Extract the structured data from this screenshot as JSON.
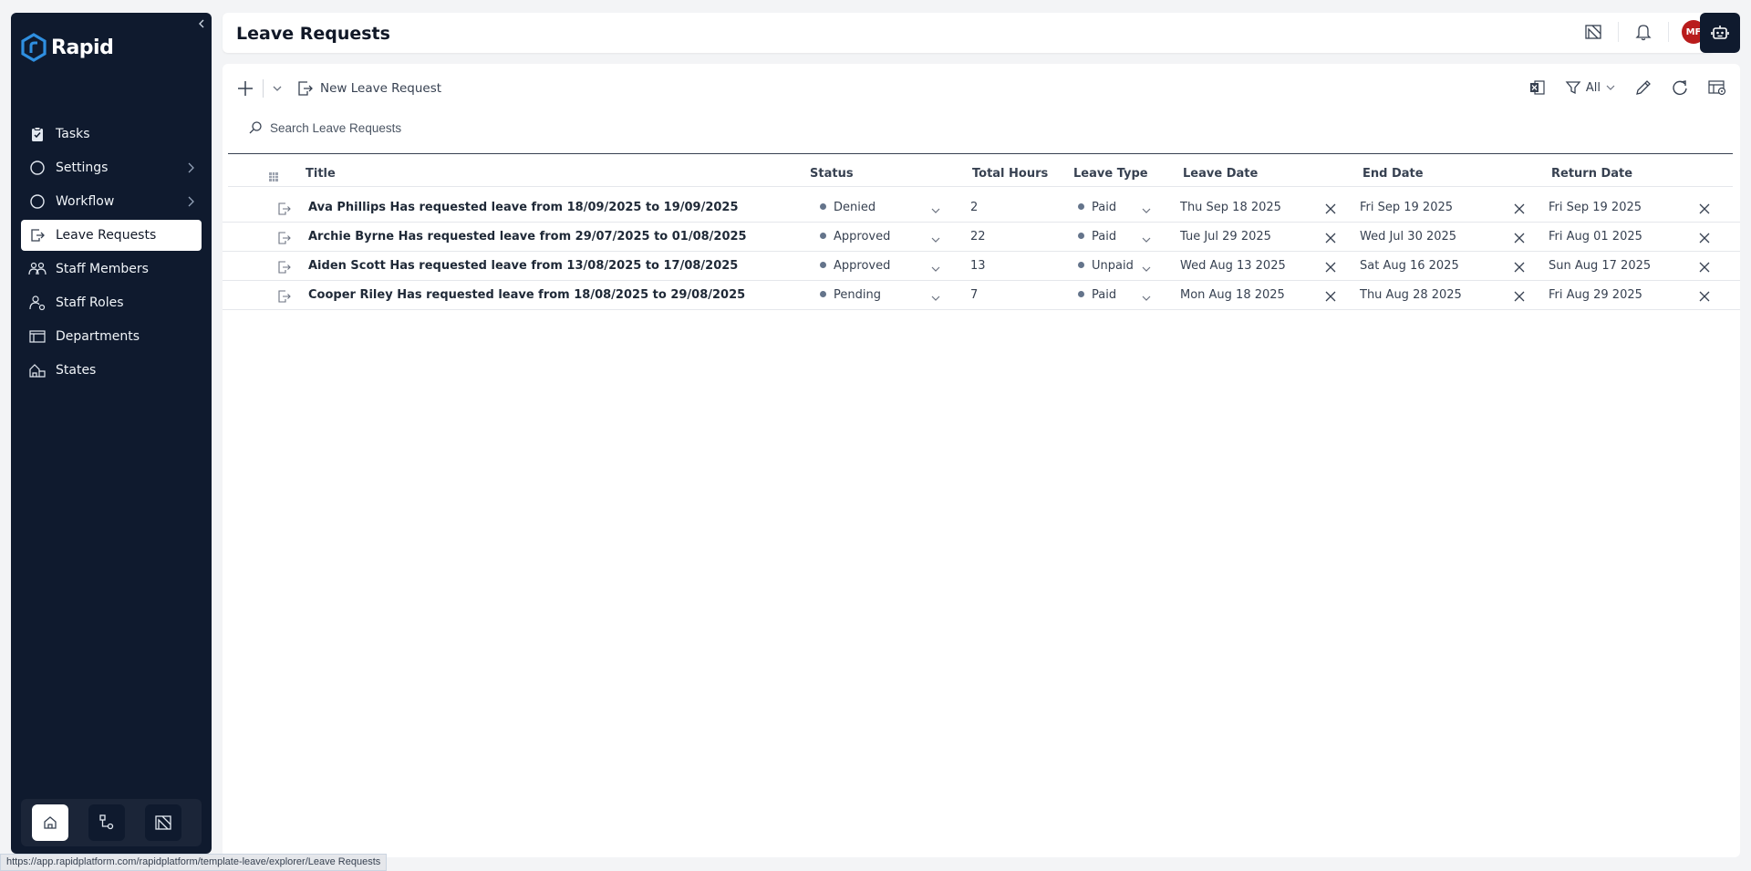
{
  "app": {
    "logo_text": "Rapid",
    "page_title": "Leave Requests",
    "avatar_initials": "MF"
  },
  "sidebar": {
    "items": [
      {
        "label": "Tasks",
        "icon": "clipboard-icon"
      },
      {
        "label": "Settings",
        "icon": "circle-icon"
      },
      {
        "label": "Workflow",
        "icon": "circle-icon"
      },
      {
        "label": "Leave Requests",
        "icon": "door-exit-icon"
      },
      {
        "label": "Staff Members",
        "icon": "people-icon"
      },
      {
        "label": "Staff Roles",
        "icon": "roles-icon"
      },
      {
        "label": "Departments",
        "icon": "table-icon"
      },
      {
        "label": "States",
        "icon": "buildings-icon"
      }
    ]
  },
  "toolbar": {
    "new_label": "New Leave Request",
    "filter_label": "All",
    "search_placeholder": "Search Leave Requests"
  },
  "table": {
    "columns": [
      "Title",
      "Status",
      "Total Hours",
      "Leave Type",
      "Leave Date",
      "End Date",
      "Return Date"
    ],
    "rows": [
      {
        "title": "Ava Phillips Has requested leave from 18/09/2025 to 19/09/2025",
        "status": "Denied",
        "hours": "2",
        "type": "Paid",
        "leave_date": "Thu Sep 18 2025",
        "end_date": "Fri Sep 19 2025",
        "return_date": "Fri Sep 19 2025"
      },
      {
        "title": "Archie Byrne Has requested leave from 29/07/2025 to 01/08/2025",
        "status": "Approved",
        "hours": "22",
        "type": "Paid",
        "leave_date": "Tue Jul 29 2025",
        "end_date": "Wed Jul 30 2025",
        "return_date": "Fri Aug 01 2025"
      },
      {
        "title": "Aiden Scott Has requested leave from 13/08/2025 to 17/08/2025",
        "status": "Approved",
        "hours": "13",
        "type": "Unpaid",
        "leave_date": "Wed Aug 13 2025",
        "end_date": "Sat Aug 16 2025",
        "return_date": "Sun Aug 17 2025"
      },
      {
        "title": "Cooper Riley Has requested leave from 18/08/2025 to 29/08/2025",
        "status": "Pending",
        "hours": "7",
        "type": "Paid",
        "leave_date": "Mon Aug 18 2025",
        "end_date": "Thu Aug 28 2025",
        "return_date": "Fri Aug 29 2025"
      }
    ]
  },
  "statusbar": {
    "url": "https://app.rapidplatform.com/rapidplatform/template-leave/explorer/Leave Requests"
  },
  "colors": {
    "sidebar_bg": "#0f1a2e",
    "logo_accent": "#2f8fe0",
    "avatar_bg": "#b91c1c"
  }
}
